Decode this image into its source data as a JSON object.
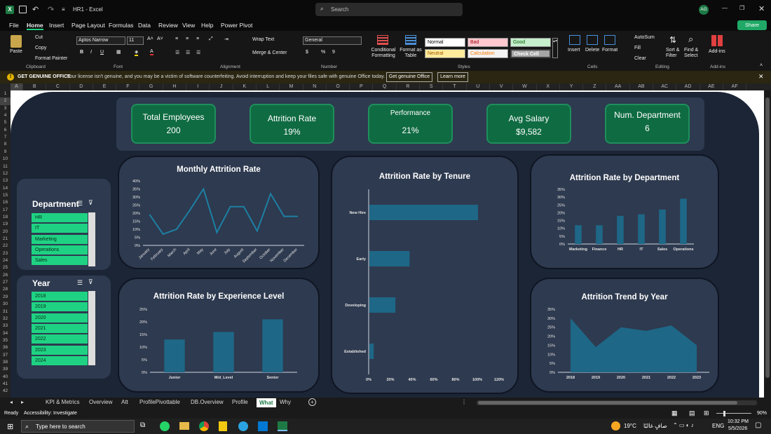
{
  "window": {
    "title": "HR1 - Excel",
    "search_placeholder": "Search",
    "user_initials": "AG"
  },
  "menu": [
    "File",
    "Home",
    "Insert",
    "Page Layout",
    "Formulas",
    "Data",
    "Review",
    "View",
    "Help",
    "Power Pivot"
  ],
  "share_label": "Share",
  "ribbon": {
    "clipboard": {
      "paste": "Paste",
      "cut": "Cut",
      "copy": "Copy",
      "format_painter": "Format Painter",
      "label": "Clipboard"
    },
    "font": {
      "name": "Aptos Narrow",
      "size": "11",
      "label": "Font"
    },
    "alignment": {
      "wrap": "Wrap Text",
      "merge": "Merge & Center",
      "label": "Alignment"
    },
    "number": {
      "format": "General",
      "label": "Number"
    },
    "styles": {
      "conditional": "Conditional Formatting",
      "format_table": "Format as Table",
      "normal": "Normal",
      "bad": "Bad",
      "good": "Good",
      "neutral": "Neutral",
      "calculation": "Calculation",
      "check_cell": "Check Cell",
      "label": "Styles"
    },
    "cells": {
      "insert": "Insert",
      "delete": "Delete",
      "format": "Format",
      "label": "Cells"
    },
    "editing": {
      "autosum": "AutoSum",
      "fill": "Fill",
      "clear": "Clear",
      "sort": "Sort & Filter",
      "find": "Find & Select",
      "label": "Editing"
    },
    "addins": {
      "addins": "Add-ins",
      "label": "Add-ins"
    }
  },
  "warning": {
    "title": "GET GENUINE OFFICE",
    "text": "Your license isn't genuine, and you may be a victim of software counterfeiting. Avoid interruption and keep your files safe with genuine Office today.",
    "btn1": "Get genuine Office",
    "btn2": "Learn more"
  },
  "columns": [
    "A",
    "B",
    "C",
    "D",
    "E",
    "F",
    "G",
    "H",
    "I",
    "J",
    "K",
    "L",
    "M",
    "N",
    "O",
    "P",
    "Q",
    "R",
    "S",
    "T",
    "U",
    "V",
    "W",
    "X",
    "Y",
    "Z",
    "AA",
    "AB",
    "AC",
    "AD",
    "AE",
    "AF"
  ],
  "rows": [
    "1",
    "2",
    "3",
    "4",
    "5",
    "6",
    "7",
    "8",
    "9",
    "10",
    "11",
    "12",
    "13",
    "14",
    "15",
    "16",
    "17",
    "18",
    "19",
    "20",
    "21",
    "22",
    "23",
    "24",
    "25",
    "26",
    "27",
    "28",
    "29",
    "30",
    "31",
    "32",
    "33",
    "34",
    "35",
    "36",
    "37",
    "38",
    "39",
    "40",
    "41",
    "42"
  ],
  "kpis": [
    {
      "title": "Total Employees",
      "value": "200"
    },
    {
      "title": "Attrition Rate",
      "value": "19%"
    },
    {
      "title": "Performance",
      "value": "21%"
    },
    {
      "title": "Avg Salary",
      "value": "$9,582"
    },
    {
      "title": "Num. Department",
      "value": "6"
    }
  ],
  "slicers": {
    "department": {
      "title": "Department",
      "items": [
        "HR",
        "IT",
        "Marketing",
        "Operations",
        "Sales"
      ]
    },
    "year": {
      "title": "Year",
      "items": [
        "2018",
        "2019",
        "2020",
        "2021",
        "2022",
        "2023",
        "2024"
      ]
    }
  },
  "chart_data": [
    {
      "type": "line",
      "title": "Monthly Attrition Rate",
      "categories": [
        "January",
        "February",
        "March",
        "April",
        "May",
        "June",
        "July",
        "August",
        "September",
        "October",
        "November",
        "December"
      ],
      "values": [
        0.19,
        0.07,
        0.1,
        0.22,
        0.35,
        0.08,
        0.24,
        0.24,
        0.09,
        0.32,
        0.18,
        0.18
      ],
      "yticks": [
        "0%",
        "5%",
        "10%",
        "15%",
        "20%",
        "25%",
        "30%",
        "35%",
        "40%"
      ],
      "ylim": [
        0,
        0.4
      ]
    },
    {
      "type": "bar",
      "orientation": "horizontal",
      "title": "Attrition Rate by Tenure",
      "categories": [
        "New Hire",
        "Early",
        "Developing",
        "Established"
      ],
      "values": [
        1.0,
        0.37,
        0.24,
        0.04
      ],
      "xticks": [
        "0%",
        "20%",
        "40%",
        "60%",
        "80%",
        "100%",
        "120%"
      ],
      "xlim": [
        0,
        1.2
      ]
    },
    {
      "type": "bar",
      "title": "Attrition Rate by Department",
      "categories": [
        "Marketing",
        "Finance",
        "HR",
        "IT",
        "Sales",
        "Operations"
      ],
      "values": [
        0.12,
        0.12,
        0.18,
        0.19,
        0.22,
        0.29
      ],
      "yticks": [
        "0%",
        "5%",
        "10%",
        "15%",
        "20%",
        "25%",
        "30%",
        "35%"
      ],
      "ylim": [
        0,
        0.35
      ]
    },
    {
      "type": "bar",
      "title": "Attrition Rate by Experience Level",
      "categories": [
        "Junior",
        "Mid_Level",
        "Senior"
      ],
      "values": [
        0.13,
        0.16,
        0.21
      ],
      "yticks": [
        "0%",
        "5%",
        "10%",
        "15%",
        "20%",
        "25%"
      ],
      "ylim": [
        0,
        0.25
      ]
    },
    {
      "type": "area",
      "title": "Attrition Trend by Year",
      "categories": [
        "2018",
        "2019",
        "2020",
        "2021",
        "2022",
        "2023"
      ],
      "values": [
        0.3,
        0.14,
        0.25,
        0.23,
        0.26,
        0.15
      ],
      "yticks": [
        "0%",
        "5%",
        "10%",
        "15%",
        "20%",
        "25%",
        "30%",
        "35%"
      ],
      "ylim": [
        0,
        0.35
      ]
    }
  ],
  "sheet_tabs": [
    "KPI & Metrics",
    "Overview",
    "Att",
    "ProfilePivottable",
    "DB.Overview",
    "Profile",
    "What",
    "Why"
  ],
  "active_tab": "What",
  "status": {
    "ready": "Ready",
    "accessibility": "Accessibility: Investigate",
    "zoom": "90%"
  },
  "taskbar": {
    "search": "Type here to search",
    "weather": "19°C",
    "weather_text": "صافٍ غالبًا",
    "lang": "ENG",
    "time": "10:32 PM",
    "date": "5/5/2026"
  },
  "colors": {
    "kpi": "#0f6b42",
    "bar": "#1e6787",
    "slicer": "#1fd283",
    "card": "#2e3a4f",
    "bg": "#1b2536"
  }
}
